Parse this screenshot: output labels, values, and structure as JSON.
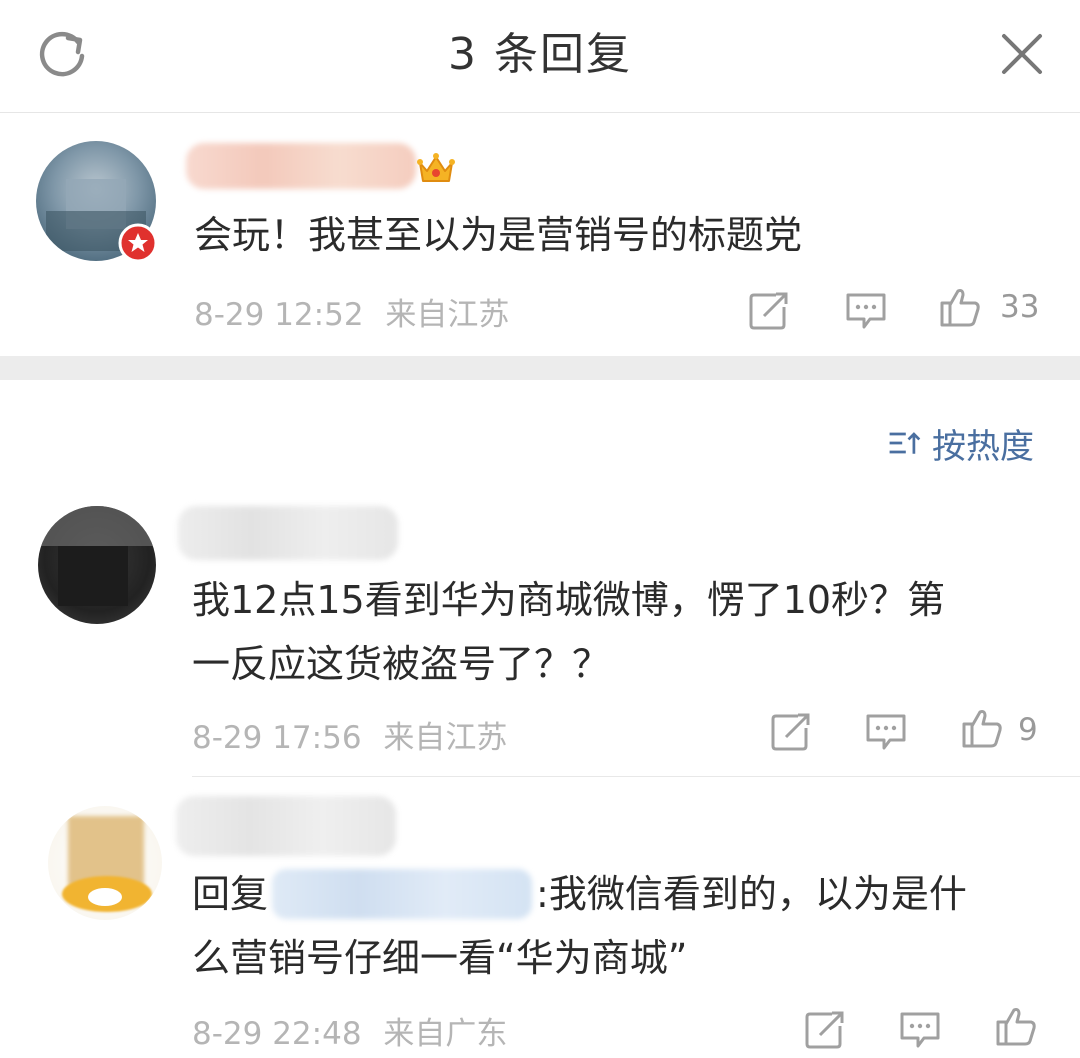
{
  "header": {
    "title": "3 条回复",
    "refresh_icon": "refresh-icon",
    "close_icon": "close-icon"
  },
  "main_comment": {
    "text": "会玩！我甚至以为是营销号的标题党",
    "time": "8-29 12:52",
    "location": "来自江苏",
    "likes": "33",
    "badge_icon": "crown-icon"
  },
  "sort": {
    "label": "按热度",
    "icon": "sort-icon"
  },
  "replies": [
    {
      "text_line1": "我12点15看到华为商城微博，愣了10秒？第",
      "text_line2": "一反应这货被盗号了？？",
      "time": "8-29 17:56",
      "location": "来自江苏",
      "likes": "9"
    },
    {
      "reply_prefix": "回复",
      "text_line1_rest": ":我微信看到的，以为是什",
      "text_line2": "么营销号仔细一看“华为商城”",
      "time": "8-29 22:48",
      "location": "来自广东",
      "likes": ""
    }
  ],
  "colors": {
    "link": "#4a6fa0",
    "meta": "#b5b5b5",
    "separator": "#ececec"
  }
}
